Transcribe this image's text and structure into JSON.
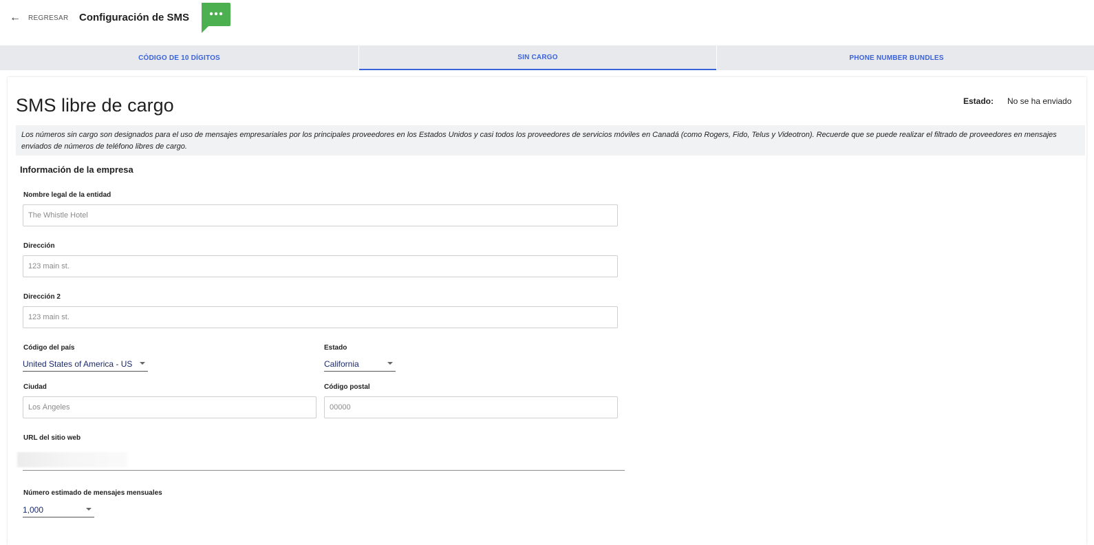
{
  "header": {
    "back_label": "REGRESAR",
    "title": "Configuración de SMS",
    "icon": "chat-bubble-icon",
    "icon_color": "#4caf50"
  },
  "tabs": [
    {
      "label": "CÓDIGO DE 10 DÍGITOS",
      "active": false
    },
    {
      "label": "SIN CARGO",
      "active": true
    },
    {
      "label": "PHONE NUMBER BUNDLES",
      "active": false
    }
  ],
  "card": {
    "title": "SMS libre de cargo",
    "status_label": "Estado:",
    "status_value": "No se ha enviado",
    "notice": "Los números sin cargo son designados para el uso de mensajes empresariales por los principales proveedores en los Estados Unidos y casi todos los proveedores de servicios móviles en Canadá (como Rogers, Fido, Telus y Videotron). Recuerde que se puede realizar el filtrado de proveedores en mensajes enviados de números de teléfono libres de cargo.",
    "section_title": "Información de la empresa"
  },
  "form": {
    "legal_name": {
      "label": "Nombre legal de la entidad",
      "placeholder": "The Whistle Hotel"
    },
    "address": {
      "label": "Dirección",
      "placeholder": "123 main st."
    },
    "address2": {
      "label": "Dirección 2",
      "placeholder": "123 main st."
    },
    "country": {
      "label": "Código del país",
      "value": "United States of America - US"
    },
    "state": {
      "label": "Estado",
      "value": "California"
    },
    "city": {
      "label": "Ciudad",
      "placeholder": "Los Ángeles"
    },
    "postal": {
      "label": "Código postal",
      "placeholder": "00000"
    },
    "website": {
      "label": "URL del sitio web"
    },
    "monthly": {
      "label": "Número estimado de mensajes mensuales",
      "value": "1,000"
    }
  },
  "colors": {
    "accent": "#3b63d9",
    "tab_bg": "#e7e9ec"
  }
}
